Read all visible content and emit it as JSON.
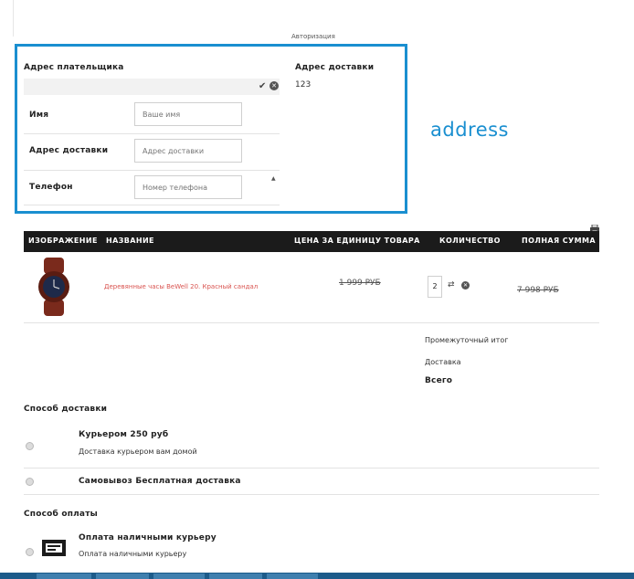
{
  "top": {
    "auth_link": "Авторизация"
  },
  "billing": {
    "title": "Адрес плательщика",
    "fields": [
      {
        "label": "Имя",
        "placeholder": "Ваше имя"
      },
      {
        "label": "Адрес доставки",
        "placeholder": "Адрес доставки"
      },
      {
        "label": "Телефон",
        "placeholder": "Номер телефона"
      }
    ]
  },
  "shipping_address": {
    "title": "Адрес доставки",
    "value": "123"
  },
  "annotation": {
    "text": "address",
    "color": "#1a8fd0"
  },
  "table": {
    "headers": [
      "ИЗОБРАЖЕНИЕ",
      "НАЗВАНИЕ",
      "ЦЕНА ЗА ЕДИНИЦУ ТОВАРА",
      "КОЛИЧЕСТВО",
      "ПОЛНАЯ СУММА"
    ],
    "rows": [
      {
        "name": "Деревянные часы BeWell 20. Красный сандал",
        "unit_price": "1 999 РУБ",
        "quantity": "2",
        "total": "7 998 РУБ"
      }
    ]
  },
  "totals": {
    "subtotal_label": "Промежуточный итог",
    "delivery_label": "Доставка",
    "total_label": "Всего"
  },
  "delivery": {
    "title": "Способ доставки",
    "options": [
      {
        "name": "Курьером",
        "price": "250 руб",
        "desc": "Доставка курьером вам домой"
      },
      {
        "name": "Самовывоз",
        "price": "Бесплатная доставка",
        "desc": ""
      }
    ]
  },
  "payment": {
    "title": "Способ оплаты",
    "options": [
      {
        "name": "Оплата наличными курьеру",
        "desc": "Оплата наличными курьеру"
      }
    ]
  },
  "colors": {
    "accent_border": "#1a8fd0",
    "table_header": "#1b1b1b",
    "product_link": "#d9534f",
    "taskbar": "#1c5b8a"
  }
}
